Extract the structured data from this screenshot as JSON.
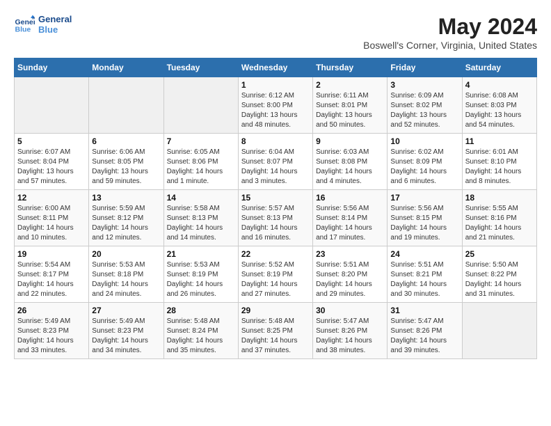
{
  "header": {
    "logo_line1": "General",
    "logo_line2": "Blue",
    "month": "May 2024",
    "location": "Boswell's Corner, Virginia, United States"
  },
  "weekdays": [
    "Sunday",
    "Monday",
    "Tuesday",
    "Wednesday",
    "Thursday",
    "Friday",
    "Saturday"
  ],
  "weeks": [
    [
      {
        "day": "",
        "info": ""
      },
      {
        "day": "",
        "info": ""
      },
      {
        "day": "",
        "info": ""
      },
      {
        "day": "1",
        "info": "Sunrise: 6:12 AM\nSunset: 8:00 PM\nDaylight: 13 hours\nand 48 minutes."
      },
      {
        "day": "2",
        "info": "Sunrise: 6:11 AM\nSunset: 8:01 PM\nDaylight: 13 hours\nand 50 minutes."
      },
      {
        "day": "3",
        "info": "Sunrise: 6:09 AM\nSunset: 8:02 PM\nDaylight: 13 hours\nand 52 minutes."
      },
      {
        "day": "4",
        "info": "Sunrise: 6:08 AM\nSunset: 8:03 PM\nDaylight: 13 hours\nand 54 minutes."
      }
    ],
    [
      {
        "day": "5",
        "info": "Sunrise: 6:07 AM\nSunset: 8:04 PM\nDaylight: 13 hours\nand 57 minutes."
      },
      {
        "day": "6",
        "info": "Sunrise: 6:06 AM\nSunset: 8:05 PM\nDaylight: 13 hours\nand 59 minutes."
      },
      {
        "day": "7",
        "info": "Sunrise: 6:05 AM\nSunset: 8:06 PM\nDaylight: 14 hours\nand 1 minute."
      },
      {
        "day": "8",
        "info": "Sunrise: 6:04 AM\nSunset: 8:07 PM\nDaylight: 14 hours\nand 3 minutes."
      },
      {
        "day": "9",
        "info": "Sunrise: 6:03 AM\nSunset: 8:08 PM\nDaylight: 14 hours\nand 4 minutes."
      },
      {
        "day": "10",
        "info": "Sunrise: 6:02 AM\nSunset: 8:09 PM\nDaylight: 14 hours\nand 6 minutes."
      },
      {
        "day": "11",
        "info": "Sunrise: 6:01 AM\nSunset: 8:10 PM\nDaylight: 14 hours\nand 8 minutes."
      }
    ],
    [
      {
        "day": "12",
        "info": "Sunrise: 6:00 AM\nSunset: 8:11 PM\nDaylight: 14 hours\nand 10 minutes."
      },
      {
        "day": "13",
        "info": "Sunrise: 5:59 AM\nSunset: 8:12 PM\nDaylight: 14 hours\nand 12 minutes."
      },
      {
        "day": "14",
        "info": "Sunrise: 5:58 AM\nSunset: 8:13 PM\nDaylight: 14 hours\nand 14 minutes."
      },
      {
        "day": "15",
        "info": "Sunrise: 5:57 AM\nSunset: 8:13 PM\nDaylight: 14 hours\nand 16 minutes."
      },
      {
        "day": "16",
        "info": "Sunrise: 5:56 AM\nSunset: 8:14 PM\nDaylight: 14 hours\nand 17 minutes."
      },
      {
        "day": "17",
        "info": "Sunrise: 5:56 AM\nSunset: 8:15 PM\nDaylight: 14 hours\nand 19 minutes."
      },
      {
        "day": "18",
        "info": "Sunrise: 5:55 AM\nSunset: 8:16 PM\nDaylight: 14 hours\nand 21 minutes."
      }
    ],
    [
      {
        "day": "19",
        "info": "Sunrise: 5:54 AM\nSunset: 8:17 PM\nDaylight: 14 hours\nand 22 minutes."
      },
      {
        "day": "20",
        "info": "Sunrise: 5:53 AM\nSunset: 8:18 PM\nDaylight: 14 hours\nand 24 minutes."
      },
      {
        "day": "21",
        "info": "Sunrise: 5:53 AM\nSunset: 8:19 PM\nDaylight: 14 hours\nand 26 minutes."
      },
      {
        "day": "22",
        "info": "Sunrise: 5:52 AM\nSunset: 8:19 PM\nDaylight: 14 hours\nand 27 minutes."
      },
      {
        "day": "23",
        "info": "Sunrise: 5:51 AM\nSunset: 8:20 PM\nDaylight: 14 hours\nand 29 minutes."
      },
      {
        "day": "24",
        "info": "Sunrise: 5:51 AM\nSunset: 8:21 PM\nDaylight: 14 hours\nand 30 minutes."
      },
      {
        "day": "25",
        "info": "Sunrise: 5:50 AM\nSunset: 8:22 PM\nDaylight: 14 hours\nand 31 minutes."
      }
    ],
    [
      {
        "day": "26",
        "info": "Sunrise: 5:49 AM\nSunset: 8:23 PM\nDaylight: 14 hours\nand 33 minutes."
      },
      {
        "day": "27",
        "info": "Sunrise: 5:49 AM\nSunset: 8:23 PM\nDaylight: 14 hours\nand 34 minutes."
      },
      {
        "day": "28",
        "info": "Sunrise: 5:48 AM\nSunset: 8:24 PM\nDaylight: 14 hours\nand 35 minutes."
      },
      {
        "day": "29",
        "info": "Sunrise: 5:48 AM\nSunset: 8:25 PM\nDaylight: 14 hours\nand 37 minutes."
      },
      {
        "day": "30",
        "info": "Sunrise: 5:47 AM\nSunset: 8:26 PM\nDaylight: 14 hours\nand 38 minutes."
      },
      {
        "day": "31",
        "info": "Sunrise: 5:47 AM\nSunset: 8:26 PM\nDaylight: 14 hours\nand 39 minutes."
      },
      {
        "day": "",
        "info": ""
      }
    ]
  ]
}
